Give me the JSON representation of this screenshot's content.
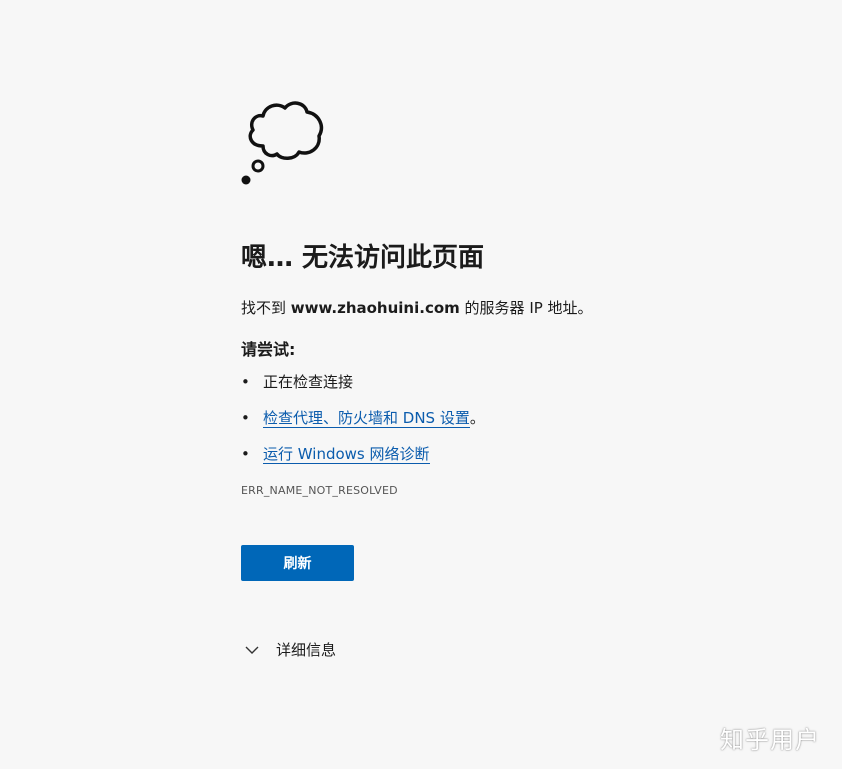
{
  "error_page": {
    "icon": "thought-cloud-icon",
    "title": "嗯… 无法访问此页面",
    "description_prefix": "找不到 ",
    "hostname": "www.zhaohuini.com",
    "description_suffix": " 的服务器 IP 地址。",
    "try_heading": "请尝试:",
    "suggestions": [
      {
        "bullet": "•",
        "text": "正在检查连接"
      },
      {
        "bullet": "•",
        "link": "检查代理、防火墙和 DNS 设置",
        "suffix": "。"
      },
      {
        "bullet": "•",
        "link": "运行 Windows 网络诊断"
      }
    ],
    "error_code": "ERR_NAME_NOT_RESOLVED",
    "refresh_label": "刷新",
    "details_label": "详细信息"
  },
  "watermark": "知乎用户",
  "colors": {
    "background": "#f7f7f7",
    "button": "#0067b8",
    "link": "#0b5cad"
  }
}
